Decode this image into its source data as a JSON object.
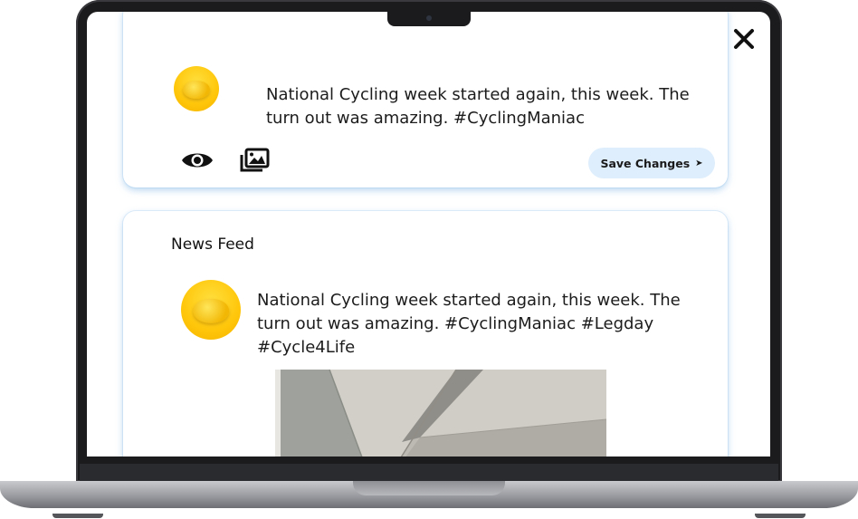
{
  "app": {
    "close_label": "✕"
  },
  "composer": {
    "text": "National Cycling week started again, this week. The turn out was amazing. #CyclingManiac",
    "preview_icon": "eye-icon",
    "media_icon": "image-gallery-icon",
    "save_label": "Save Changes",
    "save_arrow": "➤"
  },
  "feed": {
    "title": "News Feed",
    "posts": [
      {
        "text": "National Cycling week started again, this week. The turn out was amazing. #CyclingManiac #Legday #Cycle4Life"
      }
    ]
  },
  "colors": {
    "accent_button": "#deeefc",
    "card_shadow": "#a0c8eb",
    "avatar_yellow": "#ffc60a"
  }
}
